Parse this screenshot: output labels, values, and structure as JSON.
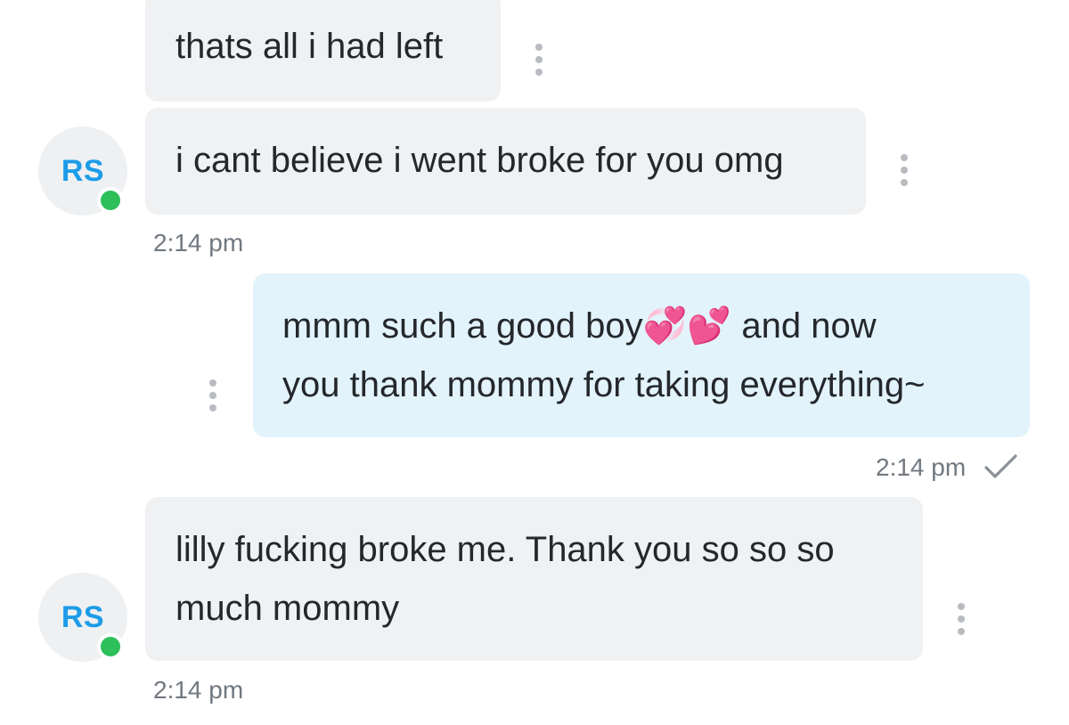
{
  "messages": [
    {
      "text": "thats all i had left"
    },
    {
      "text": "i cant believe i went broke for you omg",
      "avatar": "RS",
      "time": "2:14 pm"
    },
    {
      "line1": "mmm such a good boy💞💕 and now",
      "line2": "you thank mommy for taking everything~",
      "time": "2:14 pm"
    },
    {
      "line1": "lilly fucking broke me. Thank you so so so",
      "line2": "much mommy",
      "avatar": "RS",
      "time": "2:14 pm"
    }
  ],
  "icons": {
    "more": "more-vertical-icon",
    "read_receipt": "check-icon",
    "online": "online-status-dot"
  },
  "colors": {
    "incoming_bubble": "#f0f1f3",
    "outgoing_bubble": "#e2f3fb",
    "avatar_initials": "#1c9be8",
    "online": "#2dbf5a",
    "timestamp": "#717880"
  }
}
